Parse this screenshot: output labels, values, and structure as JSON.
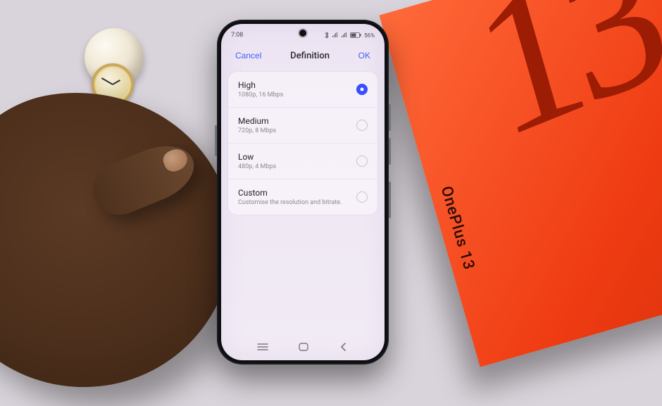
{
  "status_bar": {
    "time": "7:08",
    "battery_text": "56%"
  },
  "sheet": {
    "cancel_label": "Cancel",
    "title": "Definition",
    "ok_label": "OK"
  },
  "options": [
    {
      "label": "High",
      "sub": "1080p, 16 Mbps",
      "selected": true
    },
    {
      "label": "Medium",
      "sub": "720p, 8 Mbps",
      "selected": false
    },
    {
      "label": "Low",
      "sub": "480p, 4 Mbps",
      "selected": false
    },
    {
      "label": "Custom",
      "sub": "Customise the resolution and bitrate.",
      "selected": false
    }
  ],
  "box": {
    "number": "13",
    "brand": "OnePlus 13"
  }
}
